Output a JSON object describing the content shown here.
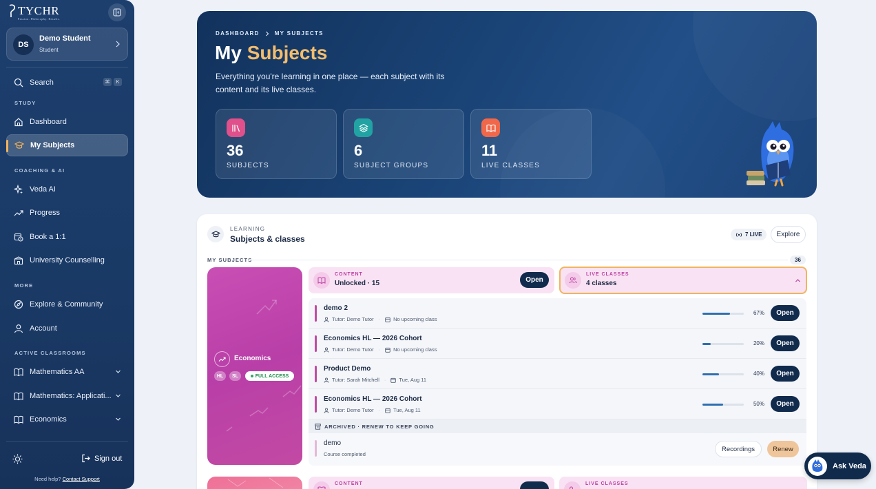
{
  "sidebar": {
    "logo": "TYCHR",
    "logo_tagline": "Passion. Philosophy. Results.",
    "user": {
      "initials": "DS",
      "name": "Demo Student",
      "role": "Student"
    },
    "search": {
      "label": "Search",
      "shortcut_1": "⌘",
      "shortcut_2": "K"
    },
    "sections": {
      "study": "STUDY",
      "coaching": "COACHING & AI",
      "more": "MORE",
      "active": "ACTIVE CLASSROOMS"
    },
    "items": {
      "dashboard": "Dashboard",
      "my_subjects": "My Subjects",
      "veda_ai": "Veda AI",
      "progress": "Progress",
      "book": "Book a 1:1",
      "counselling": "University Counselling",
      "explore": "Explore & Community",
      "account": "Account",
      "math_aa": "Mathematics AA",
      "math_ai": "Mathematics: Applicati...",
      "economics": "Economics"
    },
    "signout": "Sign out",
    "help_text": "Need help?",
    "help_link": "Contact Support"
  },
  "hero": {
    "crumb_1": "DASHBOARD",
    "crumb_2": "MY SUBJECTS",
    "title_1": "My",
    "title_2": "Subjects",
    "description": "Everything you're learning in one place — each subject with its content and its live classes.",
    "stats": [
      {
        "value": "36",
        "label": "SUBJECTS",
        "color": "#e0508a"
      },
      {
        "value": "6",
        "label": "SUBJECT GROUPS",
        "color": "#22a3a3"
      },
      {
        "value": "11",
        "label": "LIVE CLASSES",
        "color": "#f0674a"
      }
    ]
  },
  "panel": {
    "eyebrow": "LEARNING",
    "title": "Subjects & classes",
    "live_pill": "7 LIVE",
    "explore": "Explore",
    "my_subjects_label": "MY SUBJECTS",
    "count": "36",
    "subject": {
      "name": "Economics",
      "tag_hl": "HL",
      "tag_sl": "SL",
      "access": "FULL ACCESS"
    },
    "content": {
      "eyebrow": "CONTENT",
      "title": "Unlocked · 15",
      "button": "Open"
    },
    "live": {
      "eyebrow": "LIVE CLASSES",
      "title": "4 classes"
    },
    "classes": [
      {
        "title": "demo 2",
        "tutor": "Tutor: Demo Tutor",
        "next": "No upcoming class",
        "progress": 0.67,
        "pct": "67%",
        "button": "Open"
      },
      {
        "title": "Economics HL — 2026 Cohort",
        "tutor": "Tutor: Demo Tutor",
        "next": "No upcoming class",
        "progress": 0.2,
        "pct": "20%",
        "button": "Open"
      },
      {
        "title": "Product Demo",
        "tutor": "Tutor: Sarah Mitchell",
        "next": "Tue, Aug 11",
        "progress": 0.4,
        "pct": "40%",
        "button": "Open"
      },
      {
        "title": "Economics HL — 2026 Cohort",
        "tutor": "Tutor: Demo Tutor",
        "next": "Tue, Aug 11",
        "progress": 0.5,
        "pct": "50%",
        "button": "Open"
      }
    ],
    "archived_label": "ARCHIVED · RENEW TO KEEP GOING",
    "archived": {
      "title": "demo",
      "subtitle": "Course completed",
      "recordings": "Recordings",
      "renew": "Renew"
    },
    "next_content_eyebrow": "CONTENT",
    "next_live_eyebrow": "LIVE CLASSES"
  },
  "ask_veda": "Ask Veda"
}
